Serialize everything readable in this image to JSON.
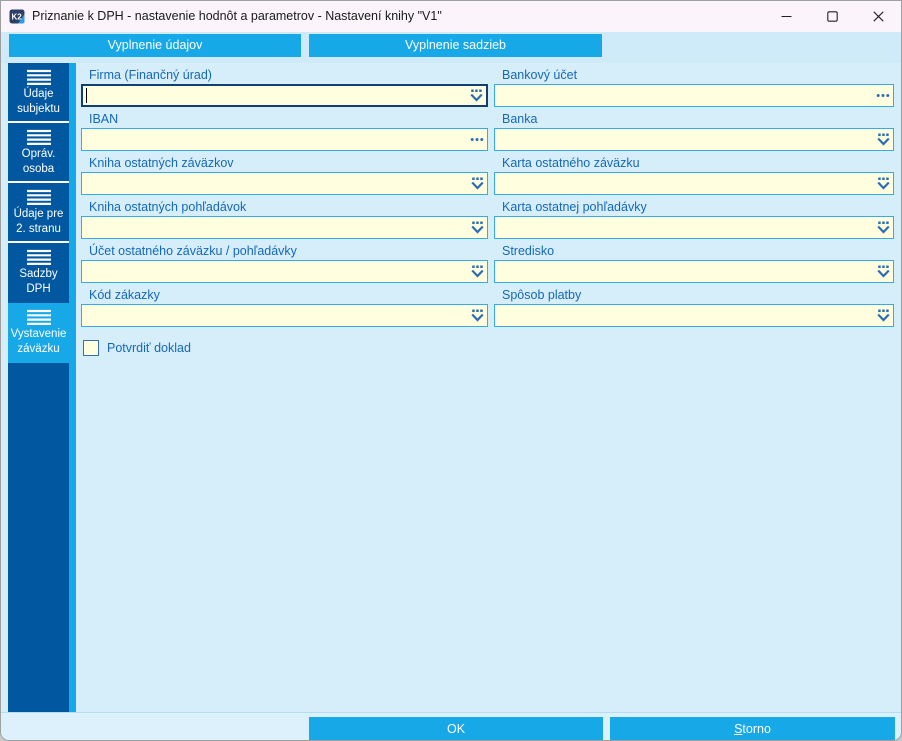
{
  "window": {
    "title": "Priznanie k DPH - nastavenie hodnôt a parametrov - Nastavení knihy \"V1\"",
    "app_icon_text": "K2"
  },
  "icons": {
    "minimize": "thin-horizontal-bar",
    "maximize": "outline-square",
    "close": "x-cross",
    "combo": "three-dots-over-chevron-down",
    "ellipsis": "three-dots",
    "sidebar_item": "hamburger-menu-lines"
  },
  "tabs": [
    {
      "label": "Vyplnenie údajov"
    },
    {
      "label": "Vyplnenie sadzieb"
    }
  ],
  "sidebar": {
    "items": [
      {
        "label": "Údaje subjektu",
        "icon": "menu",
        "selected": false
      },
      {
        "label": "Opráv. osoba",
        "icon": "menu",
        "selected": false
      },
      {
        "label": "Údaje pre 2. stranu",
        "icon": "menu",
        "selected": false
      },
      {
        "label": "Sadzby DPH",
        "icon": "menu",
        "selected": false
      },
      {
        "label": "Vystavenie záväzku",
        "icon": "menu",
        "selected": true
      }
    ]
  },
  "form": {
    "left": [
      {
        "label": "Firma (Finančný úrad)",
        "value": "",
        "icon": "combo",
        "focused": true
      },
      {
        "label": "IBAN",
        "value": "",
        "icon": "ellipsis",
        "focused": false
      },
      {
        "label": "Kniha ostatných záväzkov",
        "value": "",
        "icon": "combo",
        "focused": false
      },
      {
        "label": "Kniha ostatných pohľadávok",
        "value": "",
        "icon": "combo",
        "focused": false
      },
      {
        "label": "Účet ostatného záväzku / pohľadávky",
        "value": "",
        "icon": "combo",
        "focused": false
      },
      {
        "label": "Kód zákazky",
        "value": "",
        "icon": "combo",
        "focused": false
      }
    ],
    "right": [
      {
        "label": "Bankový účet",
        "value": "",
        "icon": "ellipsis",
        "focused": false
      },
      {
        "label": "Banka",
        "value": "",
        "icon": "combo",
        "focused": false
      },
      {
        "label": "Karta ostatného záväzku",
        "value": "",
        "icon": "combo",
        "focused": false
      },
      {
        "label": "Karta ostatnej pohľadávky",
        "value": "",
        "icon": "combo",
        "focused": false
      },
      {
        "label": "Stredisko",
        "value": "",
        "icon": "combo",
        "focused": false
      },
      {
        "label": "Spôsob platby",
        "value": "",
        "icon": "combo",
        "focused": false
      }
    ],
    "checkbox": {
      "label": "Potvrdiť doklad",
      "checked": false
    }
  },
  "footer": {
    "ok_label": "OK",
    "storno_access": "S",
    "storno_rest": "torno"
  },
  "colors": {
    "accent_cyan": "#17a8e8",
    "sidebar_blue": "#0158a0",
    "field_bg": "#ffffe0",
    "field_border": "#35ace8",
    "focus_border": "#133f70",
    "label_blue": "#1568b8",
    "content_bg": "#d6eefa",
    "titlebar_bg": "#fbf4fa"
  }
}
